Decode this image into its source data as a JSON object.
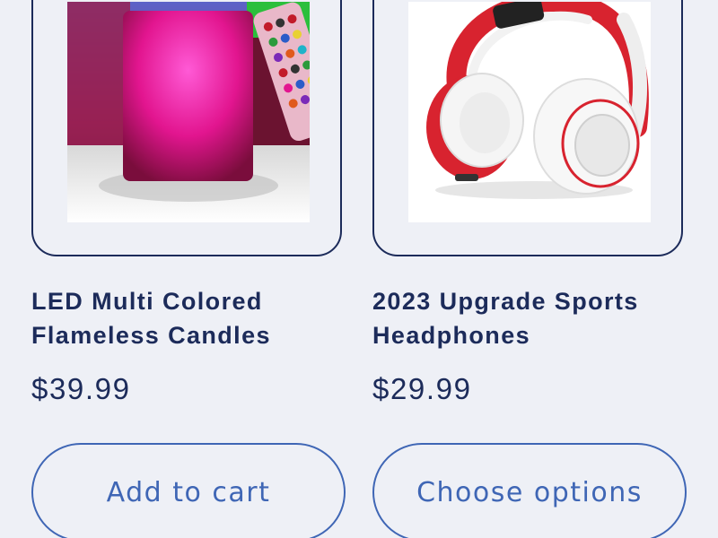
{
  "products": [
    {
      "title": "LED Multi Colored Flameless Candles",
      "price": "$39.99",
      "button_label": "Add to cart",
      "image_icon": "led-candle-image"
    },
    {
      "title": "2023 Upgrade Sports Headphones",
      "price": "$29.99",
      "button_label": "Choose options",
      "image_icon": "headphones-image"
    }
  ],
  "colors": {
    "background": "#eef0f6",
    "text": "#1c2b5a",
    "button_accent": "#3f66b5"
  }
}
